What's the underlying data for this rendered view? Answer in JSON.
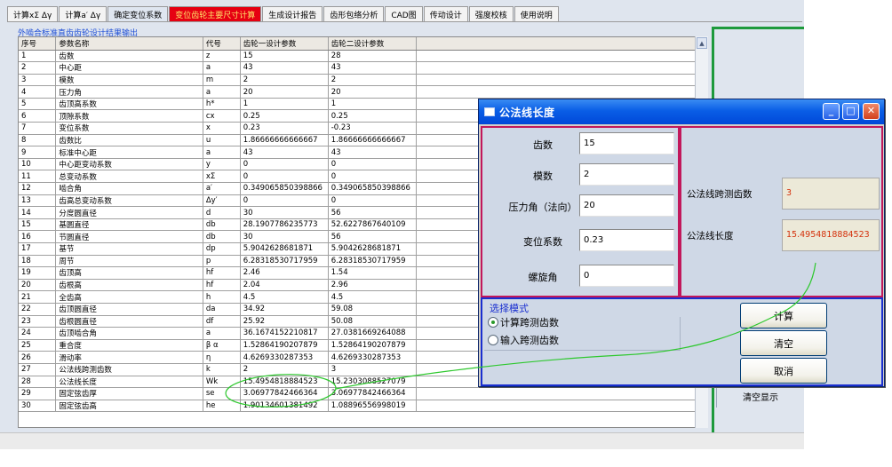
{
  "tabs": [
    {
      "label": "计算xΣ Δγ",
      "style": "normal"
    },
    {
      "label": "计算a′ Δγ",
      "style": "normal"
    },
    {
      "label": "确定变位系数",
      "style": "active"
    },
    {
      "label": "变位齿轮主要尺寸计算",
      "style": "red"
    },
    {
      "label": "生成设计报告",
      "style": "normal"
    },
    {
      "label": "齿形包络分析",
      "style": "normal"
    },
    {
      "label": "CAD图",
      "style": "normal"
    },
    {
      "label": "传动设计",
      "style": "normal"
    },
    {
      "label": "强度校核",
      "style": "normal"
    },
    {
      "label": "使用说明",
      "style": "normal"
    }
  ],
  "group_title": "外啮合标准直齿齿轮设计结果输出",
  "table": {
    "headers": [
      "序号",
      "参数名称",
      "代号",
      "齿轮一设计参数",
      "齿轮二设计参数"
    ],
    "rows": [
      [
        "1",
        "齿数",
        "z",
        "15",
        "28"
      ],
      [
        "2",
        "中心距",
        "a",
        "43",
        "43"
      ],
      [
        "3",
        "模数",
        "m",
        "2",
        "2"
      ],
      [
        "4",
        "压力角",
        "a",
        "20",
        "20"
      ],
      [
        "5",
        "齿顶高系数",
        "h*",
        "1",
        "1"
      ],
      [
        "6",
        "顶隙系数",
        "cx",
        "0.25",
        "0.25"
      ],
      [
        "7",
        "变位系数",
        "x",
        "0.23",
        "-0.23"
      ],
      [
        "8",
        "齿数比",
        "u",
        "1.86666666666667",
        "1.86666666666667"
      ],
      [
        "9",
        "标准中心距",
        "a",
        "43",
        "43"
      ],
      [
        "10",
        "中心距变动系数",
        "y",
        "0",
        "0"
      ],
      [
        "11",
        "总变动系数",
        "xΣ",
        "0",
        "0"
      ],
      [
        "12",
        "啮合角",
        "a′",
        "0.349065850398866",
        "0.349065850398866"
      ],
      [
        "13",
        "齿高总变动系数",
        "Δy′",
        "0",
        "0"
      ],
      [
        "14",
        "分度圆直径",
        "d",
        "30",
        "56"
      ],
      [
        "15",
        "基圆直径",
        "db",
        "28.1907786235773",
        "52.6227867640109"
      ],
      [
        "16",
        "节圆直径",
        "db",
        "30",
        "56"
      ],
      [
        "17",
        "基节",
        "dp",
        "5.9042628681871",
        "5.9042628681871"
      ],
      [
        "18",
        "周节",
        "p",
        "6.28318530717959",
        "6.28318530717959"
      ],
      [
        "19",
        "齿顶高",
        "hf",
        "2.46",
        "1.54"
      ],
      [
        "20",
        "齿根高",
        "hf",
        "2.04",
        "2.96"
      ],
      [
        "21",
        "全齿高",
        "h",
        "4.5",
        "4.5"
      ],
      [
        "22",
        "齿顶圆直径",
        "da",
        "34.92",
        "59.08"
      ],
      [
        "23",
        "齿根圆直径",
        "df",
        "25.92",
        "50.08"
      ],
      [
        "24",
        "齿顶啮合角",
        "a",
        "36.1674152210817",
        "27.0381669264088"
      ],
      [
        "25",
        "重合度",
        "β α",
        "1.52864190207879",
        "1.52864190207879"
      ],
      [
        "26",
        "滑动率",
        "η",
        "4.6269330287353",
        "4.6269330287353"
      ],
      [
        "27",
        "公法线跨测齿数",
        "k",
        "2",
        "3"
      ],
      [
        "28",
        "公法线长度",
        "Wk",
        "15.4954818884523",
        "15.2303088527079"
      ],
      [
        "29",
        "固定弦齿厚",
        "se",
        "3.06977842466364",
        "3.06977842466364"
      ],
      [
        "30",
        "固定弦齿高",
        "he",
        "1.90134601381492",
        "1.08896556998019"
      ]
    ]
  },
  "right_panel": {
    "clear_display_label": "清空显示"
  },
  "dialog": {
    "title": "公法线长度",
    "inputs": [
      {
        "label": "齿数",
        "value": "15"
      },
      {
        "label": "模数",
        "value": "2"
      },
      {
        "label": "压力角（法向）",
        "value": "20"
      },
      {
        "label": "变位系数",
        "value": "0.23"
      },
      {
        "label": "螺旋角",
        "value": "0"
      }
    ],
    "results": [
      {
        "label": "公法线跨测齿数",
        "value": "3"
      },
      {
        "label": "公法线长度",
        "value": "15.4954818884523"
      }
    ],
    "mode": {
      "title": "选择模式",
      "options": [
        {
          "label": "计算跨测齿数",
          "selected": true
        },
        {
          "label": "输入跨测齿数",
          "selected": false
        }
      ]
    },
    "buttons": {
      "calc": "计算",
      "clear": "清空",
      "cancel": "取消"
    }
  }
}
